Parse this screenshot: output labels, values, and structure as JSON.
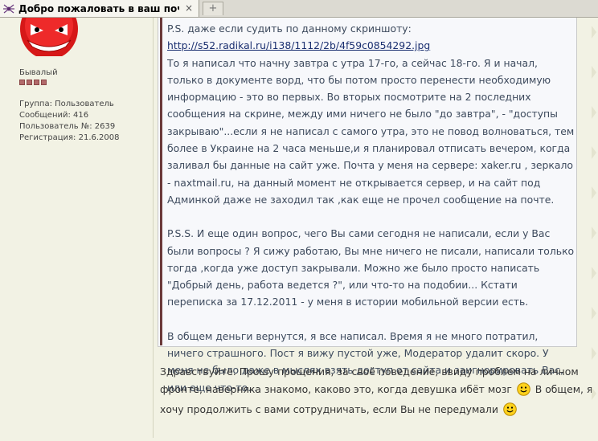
{
  "tab": {
    "title": "Добро пожаловать в ваш почто...",
    "close_label": "×",
    "new_tab_label": "+"
  },
  "profile": {
    "rank": "Бывалый",
    "info": [
      "Группа: Пользователь",
      "Сообщений: 416",
      "Пользователь №: 2639",
      "Регистрация: 21.6.2008"
    ]
  },
  "quote": {
    "p1_prefix": "P.S. даже если судить по данному скриншоту: ",
    "link": "http://s52.radikal.ru/i138/1112/2b/4f59c0854292.jpg",
    "p1_body": "То я написал что начну завтра с утра 17-го, а сейчас 18-го. Я и начал, только в документе ворд, что бы потом просто перенести необходимую информацию - это во первых. Во вторых посмотрите на 2 последних сообщения на скрине, между ими ничего не было \"до завтра\", - \"доступы закрываю\"...если я не написал с самого утра, это не повод волноваться, тем более в Украине на 2 часа меньше,и я планировал отписать вечером, когда заливал бы данные на сайт уже. Почта у меня на сервере: xaker.ru , зеркало - naxtmail.ru, на данный момент не открывается сервер, и на сайт под Админкой даже не заходил так ,как еще не прочел сообщение на почте.",
    "p2": "P.S.S. И еще один вопрос, чего Вы сами сегодня не написали, если у Вас были вопросы ? Я сижу работаю, Вы мне ничего не писали, написали только тогда ,когда уже доступ закрывали. Можно же было просто написать \"Добрый день, работа ведется ?\", или что-то на подобии... Кстати переписка за 17.12.2011 - у меня в истории мобильной версии есть.",
    "p3": "В общем деньги вернутся, я все написал. Время я не много потратил, ничего страшного. Пост я вижу пустой уже, Модератор удалит скоро. У меня не было даже в мыслях взять доступ от сайта и заигнорировать Вас, или еще что-то..."
  },
  "reply": {
    "part1": "Здравствуйте. Прошу прощения, за своё поведение, ввиду проблем на личном фронте, наверняка знакомо, каково это, когда девушка ибёт мозг",
    "part2": " В общем, я хочу продолжить с вами сотрудничать, если Вы не передумали"
  },
  "colors": {
    "background": "#f2f2e4",
    "quote_background": "#f7f8fb",
    "quote_bar": "#6b3a3a",
    "quote_text": "#3d4a5d",
    "link": "#1a2f70",
    "pip": "#b26a6a"
  },
  "icons": {
    "tab": "spider-icon",
    "close": "close-icon",
    "new_tab": "plus-icon",
    "avatar": "red-devil-smiley-avatar",
    "smiley": "smiley-icon"
  }
}
